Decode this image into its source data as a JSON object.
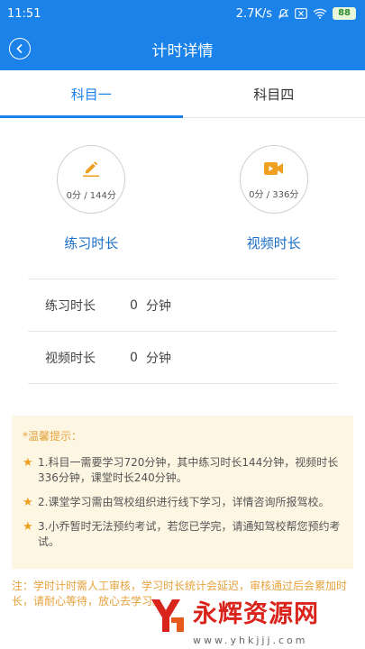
{
  "status_bar": {
    "time": "11:51",
    "speed": "2.7K/s",
    "battery": "88",
    "icons": [
      "mute-icon",
      "close-box-icon",
      "wifi-icon",
      "battery-icon"
    ]
  },
  "nav": {
    "title": "计时详情",
    "back_icon": "back-arrow-icon"
  },
  "tabs": [
    {
      "label": "科目一",
      "active": true
    },
    {
      "label": "科目四",
      "active": false
    }
  ],
  "stats": [
    {
      "value": "0分 / 144分",
      "label": "练习时长",
      "icon": "pencil-icon"
    },
    {
      "value": "0分 / 336分",
      "label": "视频时长",
      "icon": "video-icon"
    }
  ],
  "details": [
    {
      "label": "练习时长",
      "value": "0",
      "unit": "分钟"
    },
    {
      "label": "视频时长",
      "value": "0",
      "unit": "分钟"
    }
  ],
  "tips": {
    "title": "*温馨提示：",
    "items": [
      "1.科目一需要学习720分钟，其中练习时长144分钟，视频时长336分钟，课堂时长240分钟。",
      "2.课堂学习需由驾校组织进行线下学习，详情咨询所报驾校。",
      "3.小乔暂时无法预约考试，若您已学完，请通知驾校帮您预约考试。"
    ]
  },
  "note": "注：学时计时需人工审核，学习时长统计会延迟，审核通过后会累加时长，请耐心等待，放心去学习。",
  "watermark": {
    "text": "永辉资源网",
    "url": "www.yhkjjj.com"
  },
  "colors": {
    "primary": "#1a82e8",
    "accent_orange": "#f0a020",
    "tips_bg": "#fdf6e3"
  }
}
